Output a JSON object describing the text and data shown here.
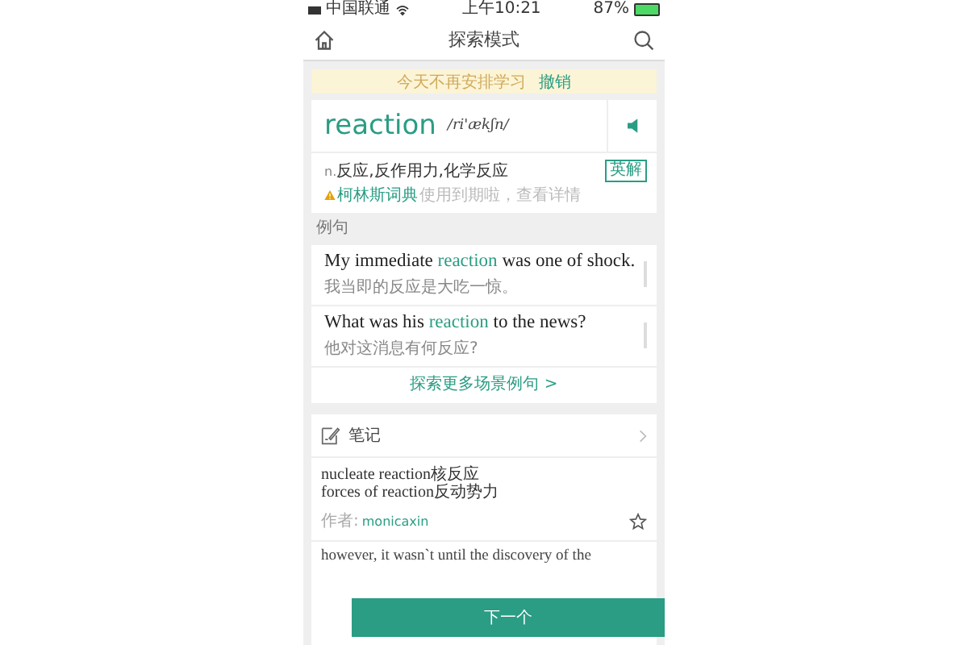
{
  "status_bar": {
    "carrier": "中国联通",
    "time": "上午10:21",
    "battery": "87%"
  },
  "header": {
    "title": "探索模式"
  },
  "banner": {
    "text": "今天不再安排学习",
    "action": "撤销"
  },
  "word": {
    "headword": "reaction",
    "phonetic": "/ri'ækʃn/",
    "pos": "n.",
    "definition": "反应,反作用力,化学反应",
    "button": "英解",
    "source": "柯林斯词典",
    "source_note": "使用到期啦，查看详情"
  },
  "examples_label": "例句",
  "examples": [
    {
      "before": "My immediate ",
      "highlight": "reaction",
      "after": " was one of shock.",
      "translation": "我当即的反应是大吃一惊。"
    },
    {
      "before": "What was his ",
      "highlight": "reaction",
      "after": " to the news?",
      "translation": "他对这消息有何反应?"
    }
  ],
  "more_examples": "探索更多场景例句 >",
  "notes": {
    "title": "笔记",
    "items": [
      {
        "lines": [
          "nucleate reaction核反应",
          "forces of reaction反动势力"
        ],
        "author_label": "作者:",
        "author": "monicaxin"
      }
    ],
    "next_preview": "however, it wasn`t until the discovery of the"
  },
  "next_button": "下一个"
}
